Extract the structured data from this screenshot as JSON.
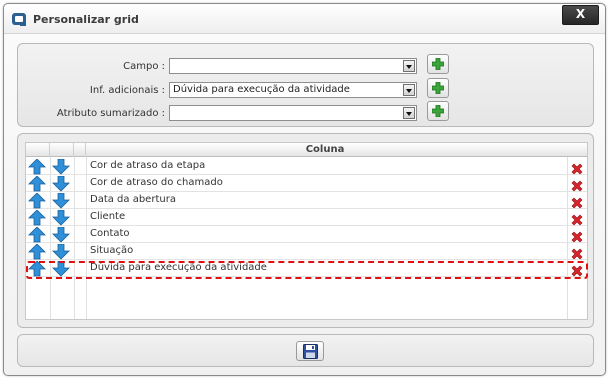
{
  "window": {
    "title": "Personalizar grid",
    "close_label": "X"
  },
  "form": {
    "fields": [
      {
        "label": "Campo :",
        "value": ""
      },
      {
        "label": "Inf. adicionais :",
        "value": "Dúvida para execução da atividade"
      },
      {
        "label": "Atributo sumarizado :",
        "value": ""
      }
    ],
    "add_icon": "plus-icon"
  },
  "grid": {
    "column_header": "Coluna",
    "rows": [
      "Cor de atraso da etapa",
      "Cor de atraso do chamado",
      "Data da abertura",
      "Cliente",
      "Contato",
      "Situação",
      "Dúvida para execução da atividade"
    ],
    "highlighted_row": "Dúvida para execução da atividade",
    "up_icon": "arrow-up-icon",
    "down_icon": "arrow-down-icon",
    "delete_icon": "delete-x-icon"
  },
  "footer": {
    "save_icon": "save-floppy-icon"
  },
  "colors": {
    "arrow_blue": "#2f8fd8",
    "delete_red": "#d9252a",
    "add_green": "#3aa53a",
    "highlight": "#e01010"
  }
}
